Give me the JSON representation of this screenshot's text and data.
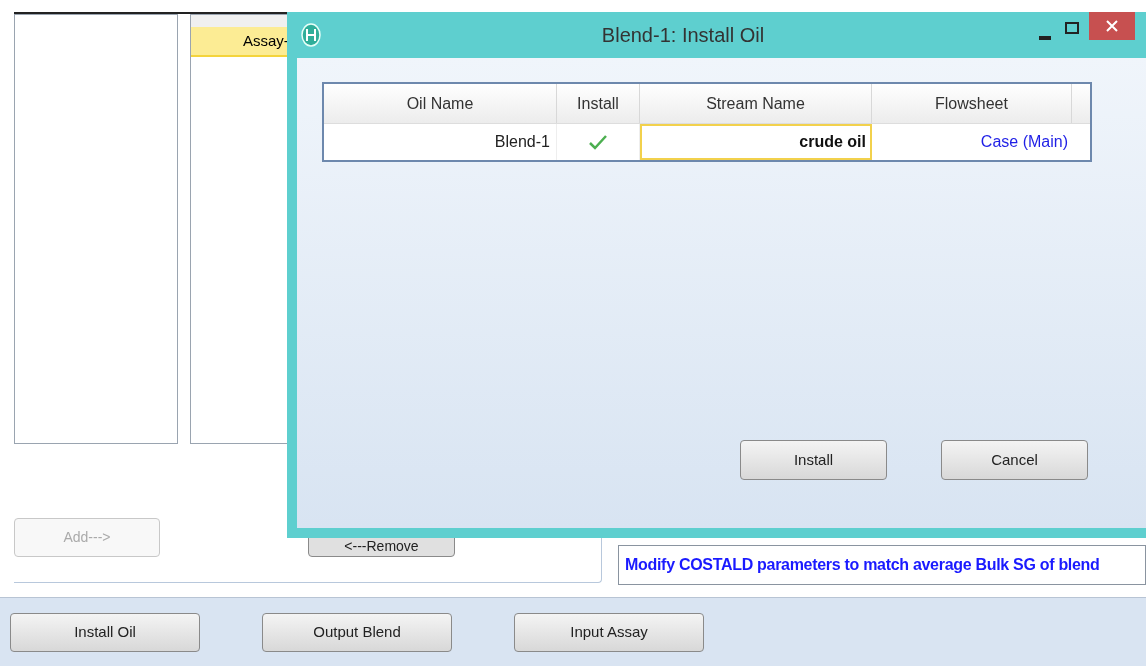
{
  "background": {
    "list_row": {
      "text": "Assay-",
      "selected": true
    },
    "add_button": {
      "label": "Add--->",
      "disabled": true
    },
    "remove_button": "<---Remove",
    "note": "Modify COSTALD parameters to match average Bulk SG of blend",
    "buttons": [
      "Install Oil",
      "Output Blend",
      "Input Assay"
    ]
  },
  "dialog": {
    "title": "Blend-1: Install Oil",
    "table": {
      "columns": [
        "Oil Name",
        "Install",
        "Stream Name",
        "Flowsheet"
      ],
      "rows": [
        {
          "oil_name": "Blend-1",
          "install": true,
          "stream_name": "crude oil",
          "flowsheet": "Case (Main)"
        }
      ]
    },
    "buttons": [
      "Install",
      "Cancel"
    ]
  }
}
